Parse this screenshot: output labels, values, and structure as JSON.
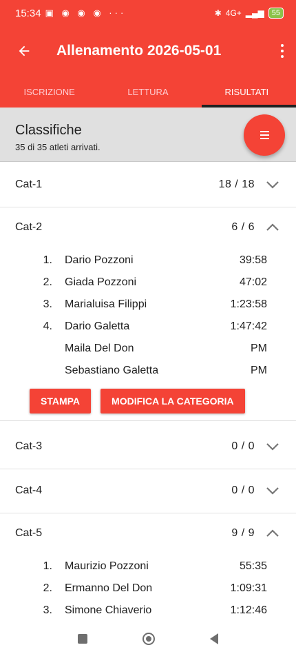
{
  "status_bar": {
    "time": "15:34",
    "battery": "55",
    "signal": "4G+"
  },
  "app_bar": {
    "title": "Allenamento 2026-05-01"
  },
  "tabs": [
    {
      "label": "ISCRIZIONE",
      "active": false
    },
    {
      "label": "LETTURA",
      "active": false
    },
    {
      "label": "RISULTATI",
      "active": true
    }
  ],
  "header": {
    "title": "Classifiche",
    "subtitle": "35 di 35 atleti arrivati."
  },
  "categories": [
    {
      "name": "Cat-1",
      "count": "18 / 18",
      "expanded": false
    },
    {
      "name": "Cat-2",
      "count": "6 / 6",
      "expanded": true,
      "results": [
        {
          "pos": "1.",
          "name": "Dario Pozzoni",
          "time": "39:58"
        },
        {
          "pos": "2.",
          "name": "Giada Pozzoni",
          "time": "47:02"
        },
        {
          "pos": "3.",
          "name": "Marialuisa Filippi",
          "time": "1:23:58"
        },
        {
          "pos": "4.",
          "name": "Dario Galetta",
          "time": "1:47:42"
        },
        {
          "pos": "",
          "name": "Maila Del Don",
          "time": "PM"
        },
        {
          "pos": "",
          "name": "Sebastiano Galetta",
          "time": "PM"
        }
      ],
      "actions": {
        "print_label": "STAMPA",
        "edit_label": "MODIFICA LA CATEGORIA"
      }
    },
    {
      "name": "Cat-3",
      "count": "0 / 0",
      "expanded": false
    },
    {
      "name": "Cat-4",
      "count": "0 / 0",
      "expanded": false
    },
    {
      "name": "Cat-5",
      "count": "9 / 9",
      "expanded": true,
      "results": [
        {
          "pos": "1.",
          "name": "Maurizio Pozzoni",
          "time": "55:35"
        },
        {
          "pos": "2.",
          "name": "Ermanno Del Don",
          "time": "1:09:31"
        },
        {
          "pos": "3.",
          "name": "Simone Chiaverio",
          "time": "1:12:46"
        }
      ]
    }
  ],
  "colors": {
    "primary": "#f44336",
    "header_bg": "#e0e0e0",
    "tab_inactive": "#ffcdd2"
  },
  "icons": [
    "back-arrow-icon",
    "overflow-menu-icon",
    "menu-icon",
    "chevron-down-icon",
    "chevron-up-icon"
  ]
}
